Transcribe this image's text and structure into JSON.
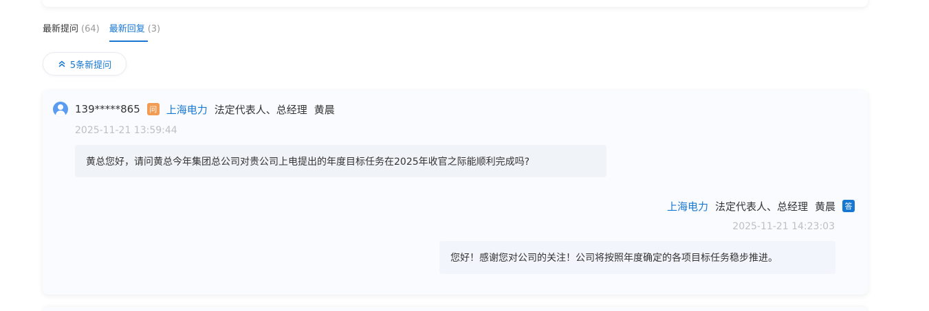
{
  "tabs": [
    {
      "label": "最新提问",
      "count": "(64)",
      "active": false
    },
    {
      "label": "最新回复",
      "count": "(3)",
      "active": true
    }
  ],
  "new_questions": {
    "label": "5条新提问",
    "icon": "double-chevron-up-icon"
  },
  "question": {
    "user_id": "139*****865",
    "badge": "问",
    "company": "上海电力",
    "role": "法定代表人、总经理",
    "person": "黄晨",
    "time": "2025-11-21 13:59:44",
    "text": "黄总您好，请问黄总今年集团总公司对贵公司上电提出的年度目标任务在2025年收官之际能顺利完成吗?"
  },
  "answer": {
    "company": "上海电力",
    "role": "法定代表人、总经理",
    "person": "黄晨",
    "badge": "答",
    "time": "2025-11-21 14:23:03",
    "text": "您好！感谢您对公司的关注！公司将按照年度确定的各项目标任务稳步推进。"
  },
  "colors": {
    "accent": "#1677d2",
    "ask_badge": "#f29b52",
    "muted": "#bfbfbf"
  }
}
